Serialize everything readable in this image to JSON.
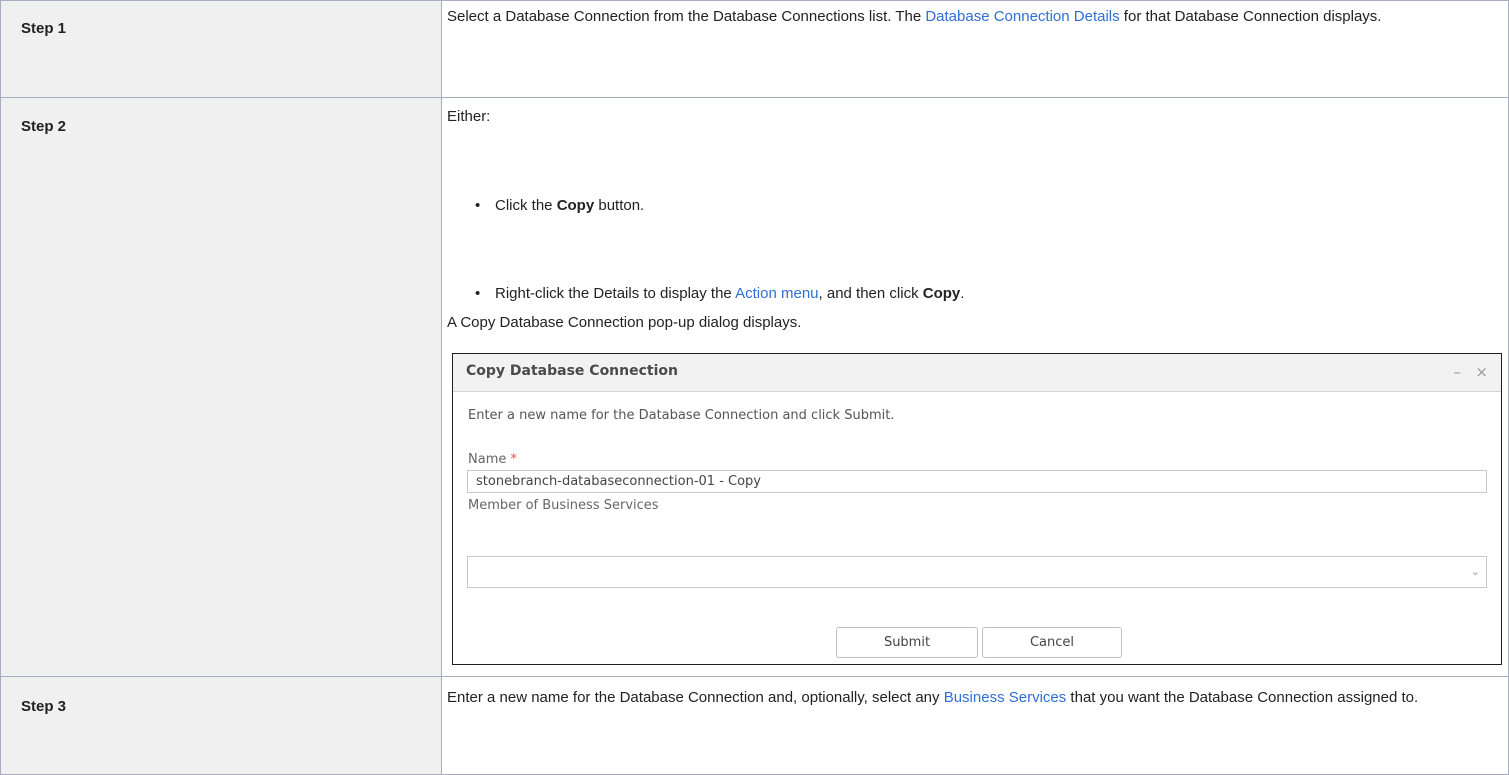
{
  "steps": [
    {
      "label": "Step 1",
      "text_a": "Select a Database Connection from the Database Connections list. The ",
      "link": "Database Connection Details",
      "text_b": " for that Database Connection displays."
    },
    {
      "label": "Step 2",
      "intro": "Either:",
      "bullet_char": "•",
      "bullet1": {
        "a": "Click the ",
        "bold": "Copy",
        "b": " button."
      },
      "bullet2": {
        "a": "Right-click the Details to display the ",
        "link": "Action menu",
        "b": ", and then click ",
        "bold": "Copy",
        "c": "."
      },
      "result": "A Copy Database Connection pop-up dialog displays."
    },
    {
      "label": "Step 3",
      "text_a": "Enter a new name for the Database Connection and, optionally, select any ",
      "link": "Business Services",
      "text_b": " that you want the Database Connection assigned to."
    }
  ],
  "dialog": {
    "title": "Copy Database Connection",
    "minimize_glyph": "–",
    "close_glyph": "×",
    "instruction": "Enter a new name for the Database Connection and click Submit.",
    "name_label": "Name",
    "required_mark": "*",
    "name_value": "stonebranch-databaseconnection-01 - Copy",
    "business_label": "Member of Business Services",
    "business_value": "",
    "dropdown_glyph": "⌄",
    "submit_label": "Submit",
    "cancel_label": "Cancel"
  }
}
